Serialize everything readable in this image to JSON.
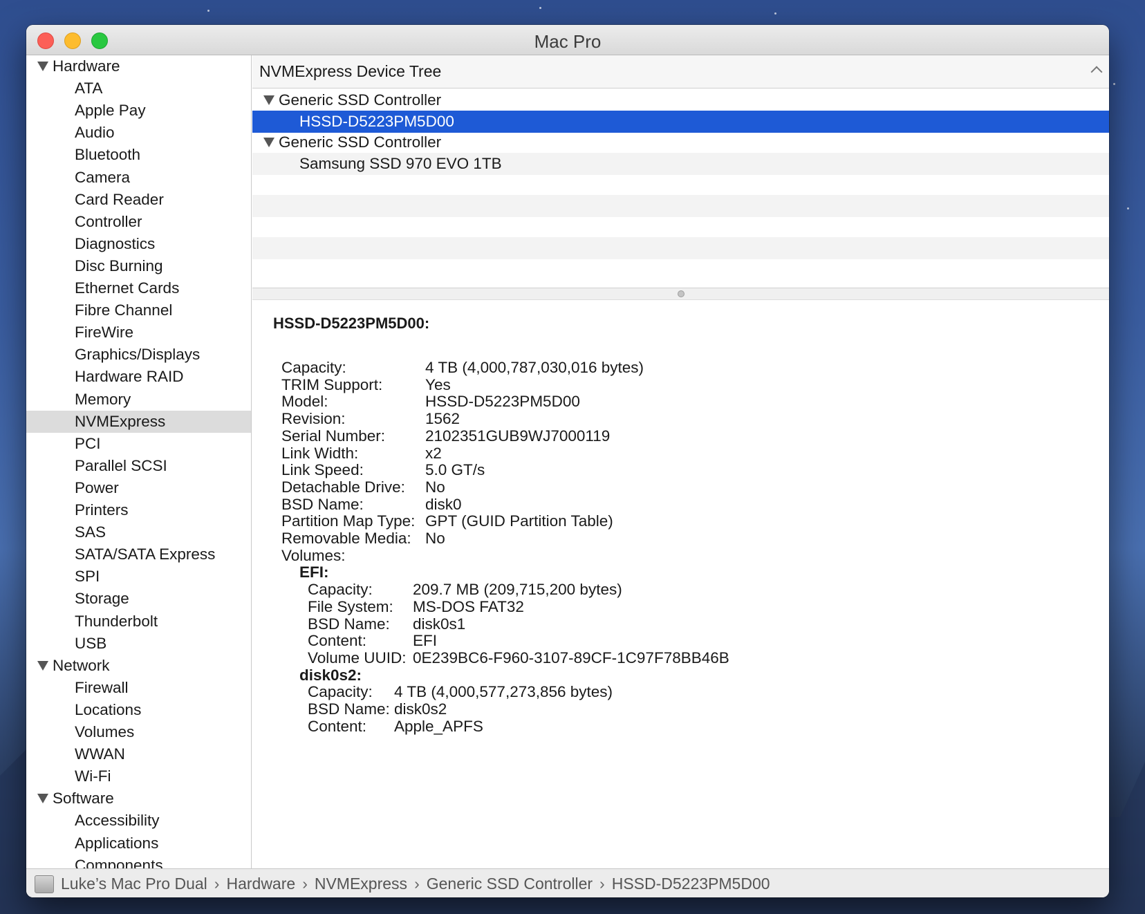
{
  "window": {
    "title": "Mac Pro"
  },
  "sidebar": {
    "groups": [
      {
        "label": "Hardware",
        "items": [
          "ATA",
          "Apple Pay",
          "Audio",
          "Bluetooth",
          "Camera",
          "Card Reader",
          "Controller",
          "Diagnostics",
          "Disc Burning",
          "Ethernet Cards",
          "Fibre Channel",
          "FireWire",
          "Graphics/Displays",
          "Hardware RAID",
          "Memory",
          "NVMExpress",
          "PCI",
          "Parallel SCSI",
          "Power",
          "Printers",
          "SAS",
          "SATA/SATA Express",
          "SPI",
          "Storage",
          "Thunderbolt",
          "USB"
        ]
      },
      {
        "label": "Network",
        "items": [
          "Firewall",
          "Locations",
          "Volumes",
          "WWAN",
          "Wi-Fi"
        ]
      },
      {
        "label": "Software",
        "items": [
          "Accessibility",
          "Applications",
          "Components"
        ]
      }
    ],
    "selected": "NVMExpress"
  },
  "pane": {
    "title": "NVMExpress Device Tree"
  },
  "tree": {
    "rows": [
      {
        "label": "Generic SSD Controller",
        "level": 0,
        "expanded": true
      },
      {
        "label": "HSSD-D5223PM5D00",
        "level": 1,
        "selected": true
      },
      {
        "label": "Generic SSD Controller",
        "level": 0,
        "expanded": true
      },
      {
        "label": "Samsung SSD 970 EVO 1TB",
        "level": 1
      }
    ]
  },
  "detail": {
    "title": "HSSD-D5223PM5D00:",
    "fields": [
      {
        "key": "Capacity:",
        "value": "4 TB (4,000,787,030,016 bytes)"
      },
      {
        "key": "TRIM Support:",
        "value": "Yes"
      },
      {
        "key": "Model:",
        "value": "HSSD-D5223PM5D00"
      },
      {
        "key": "Revision:",
        "value": "1562"
      },
      {
        "key": "Serial Number:",
        "value": "2102351GUB9WJ7000119"
      },
      {
        "key": "Link Width:",
        "value": "x2"
      },
      {
        "key": "Link Speed:",
        "value": "5.0 GT/s"
      },
      {
        "key": "Detachable Drive:",
        "value": "No"
      },
      {
        "key": "BSD Name:",
        "value": "disk0"
      },
      {
        "key": "Partition Map Type:",
        "value": "GPT (GUID Partition Table)"
      },
      {
        "key": "Removable Media:",
        "value": "No"
      },
      {
        "key": "Volumes:",
        "value": ""
      }
    ],
    "volumes": [
      {
        "name": "EFI:",
        "fields": [
          {
            "key": "Capacity:",
            "value": "209.7 MB (209,715,200 bytes)"
          },
          {
            "key": "File System:",
            "value": "MS-DOS FAT32"
          },
          {
            "key": "BSD Name:",
            "value": "disk0s1"
          },
          {
            "key": "Content:",
            "value": "EFI"
          },
          {
            "key": "Volume UUID:",
            "value": "0E239BC6-F960-3107-89CF-1C97F78BB46B"
          }
        ]
      },
      {
        "name": "disk0s2:",
        "fields": [
          {
            "key": "Capacity:",
            "value": "4 TB (4,000,577,273,856 bytes)"
          },
          {
            "key": "BSD Name:",
            "value": "disk0s2"
          },
          {
            "key": "Content:",
            "value": "Apple_APFS"
          }
        ]
      }
    ]
  },
  "statusbar": {
    "breadcrumbs": [
      "Luke’s Mac Pro Dual",
      "Hardware",
      "NVMExpress",
      "Generic SSD Controller",
      "HSSD-D5223PM5D00"
    ],
    "separator": "›"
  },
  "colors": {
    "selection": "#1e5ad6",
    "sidebar_selection": "#dcdcdc"
  }
}
